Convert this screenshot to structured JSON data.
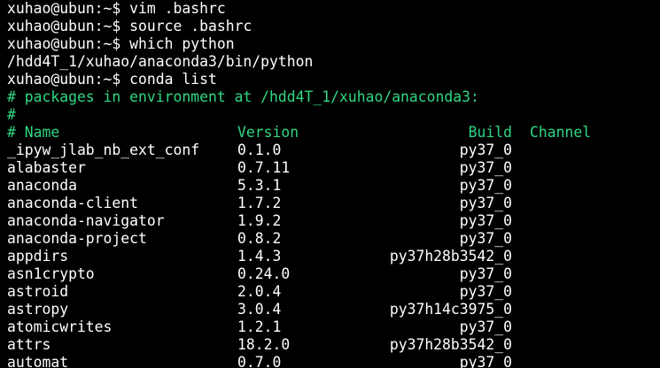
{
  "terminal": {
    "history": [
      {
        "prompt": "xuhao@ubun:~$ ",
        "command": "vim .bashrc"
      },
      {
        "prompt": "xuhao@ubun:~$ ",
        "command": "source .bashrc"
      },
      {
        "prompt": "xuhao@ubun:~$ ",
        "command": "which python"
      },
      {
        "output": "/hdd4T_1/xuhao/anaconda3/bin/python"
      },
      {
        "prompt": "xuhao@ubun:~$ ",
        "command": "conda list"
      }
    ],
    "comment_env": "# packages in environment at /hdd4T_1/xuhao/anaconda3:",
    "comment_blank": "#",
    "columns": {
      "name": "# Name",
      "version": "Version",
      "build": "Build",
      "channel": "Channel"
    },
    "packages": [
      {
        "name": "_ipyw_jlab_nb_ext_conf",
        "version": "0.1.0",
        "build": "py37_0"
      },
      {
        "name": "alabaster",
        "version": "0.7.11",
        "build": "py37_0"
      },
      {
        "name": "anaconda",
        "version": "5.3.1",
        "build": "py37_0"
      },
      {
        "name": "anaconda-client",
        "version": "1.7.2",
        "build": "py37_0"
      },
      {
        "name": "anaconda-navigator",
        "version": "1.9.2",
        "build": "py37_0"
      },
      {
        "name": "anaconda-project",
        "version": "0.8.2",
        "build": "py37_0"
      },
      {
        "name": "appdirs",
        "version": "1.4.3",
        "build": "py37h28b3542_0"
      },
      {
        "name": "asn1crypto",
        "version": "0.24.0",
        "build": "py37_0"
      },
      {
        "name": "astroid",
        "version": "2.0.4",
        "build": "py37_0"
      },
      {
        "name": "astropy",
        "version": "3.0.4",
        "build": "py37h14c3975_0"
      },
      {
        "name": "atomicwrites",
        "version": "1.2.1",
        "build": "py37_0"
      },
      {
        "name": "attrs",
        "version": "18.2.0",
        "build": "py37h28b3542_0"
      },
      {
        "name": "automat",
        "version": "0.7.0",
        "build": "py37_0"
      }
    ],
    "colors": {
      "background": "#000000",
      "text": "#ffffff",
      "comment": "#2fd882"
    }
  }
}
